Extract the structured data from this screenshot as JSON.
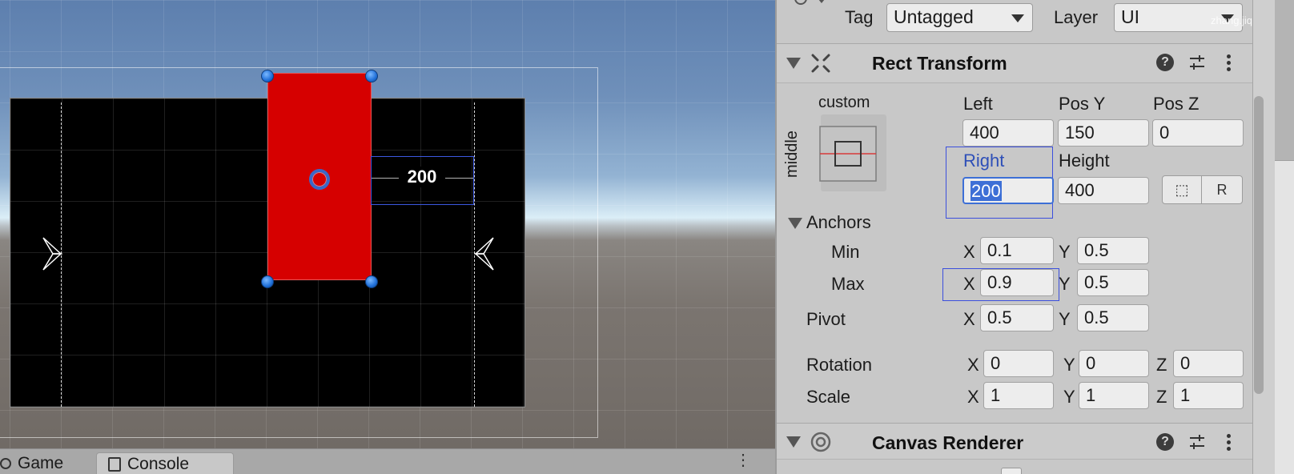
{
  "inspector": {
    "tag": {
      "label": "Tag",
      "value": "Untagged"
    },
    "layer": {
      "label": "Layer",
      "value": "UI"
    },
    "watermark": "zhang.jiquan",
    "rect_transform": {
      "title": "Rect Transform",
      "anchor_preset": {
        "horizontal": "custom",
        "vertical": "middle"
      },
      "labels": {
        "left": "Left",
        "pos_y": "Pos Y",
        "pos_z": "Pos Z",
        "right": "Right",
        "height": "Height"
      },
      "values": {
        "left": "400",
        "pos_y": "150",
        "pos_z": "0",
        "right": "200",
        "height": "400"
      },
      "blueprint_button": "⬚",
      "raw_button": "R",
      "anchors": {
        "label": "Anchors",
        "min": {
          "label": "Min",
          "x": "0.1",
          "y": "0.5"
        },
        "max": {
          "label": "Max",
          "x": "0.9",
          "y": "0.5"
        }
      },
      "pivot": {
        "label": "Pivot",
        "x": "0.5",
        "y": "0.5"
      },
      "rotation": {
        "label": "Rotation",
        "x": "0",
        "y": "0",
        "z": "0"
      },
      "scale": {
        "label": "Scale",
        "x": "1",
        "y": "1",
        "z": "1"
      },
      "axis": {
        "x": "X",
        "y": "Y",
        "z": "Z"
      }
    },
    "canvas_renderer": {
      "title": "Canvas Renderer"
    }
  },
  "scene": {
    "dimension_label": "200",
    "selected_color": "#d60000",
    "handle_color": "#1f6fd8"
  },
  "tabs": [
    {
      "label": "Game"
    },
    {
      "label": "Console"
    }
  ],
  "colors": {
    "focus_outline": "#3b4fdd",
    "selection_highlight": "#3d6fd6",
    "panel_bg": "#c8c8c8"
  }
}
